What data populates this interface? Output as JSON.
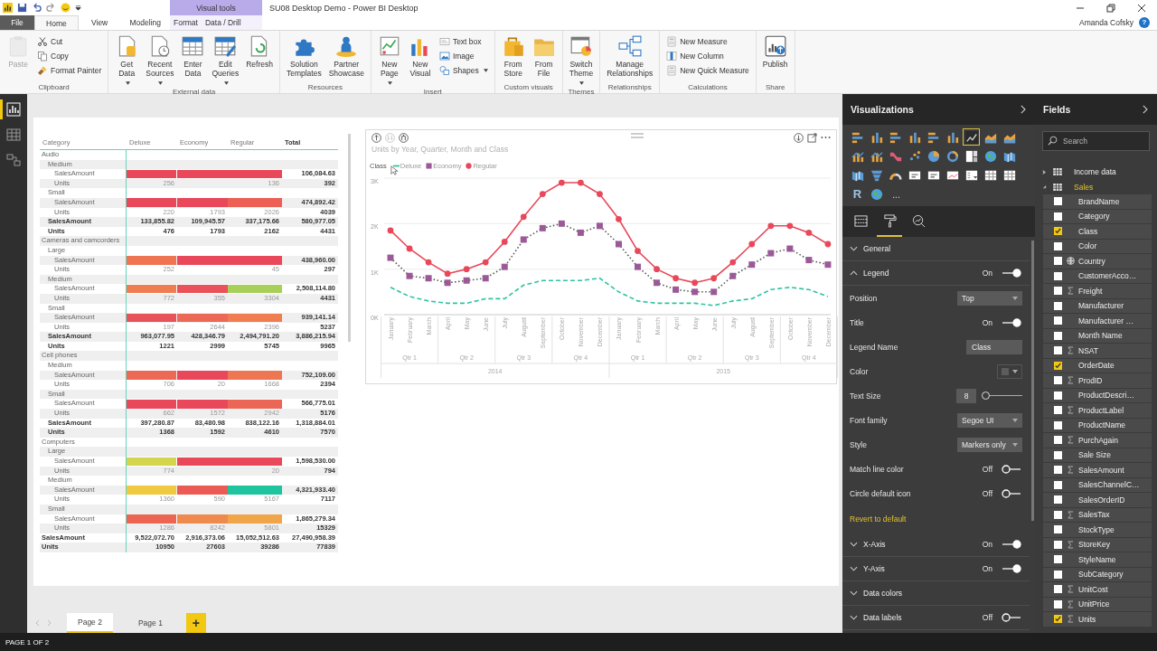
{
  "titlebar": {
    "context_group": "Visual tools",
    "title": "SU08 Desktop Demo - Power BI Desktop",
    "user": "Amanda Cofsky",
    "help": "?"
  },
  "tabs": [
    {
      "label": "File",
      "kind": "file",
      "selected": false
    },
    {
      "label": "Home",
      "kind": "standard",
      "selected": true
    },
    {
      "label": "View",
      "kind": "standard",
      "selected": false
    },
    {
      "label": "Modeling",
      "kind": "standard",
      "selected": false
    },
    {
      "label": "Format",
      "kind": "context",
      "selected": false
    },
    {
      "label": "Data / Drill",
      "kind": "context",
      "selected": false
    }
  ],
  "ribbon": {
    "groups": [
      {
        "label": "Clipboard",
        "buttons": [
          {
            "label": "Paste",
            "kind": "large",
            "dropdown": false,
            "disabled": true
          },
          {
            "label": "Cut",
            "kind": "small",
            "dropdown": false,
            "disabled": false
          },
          {
            "label": "Copy",
            "kind": "small",
            "dropdown": false,
            "disabled": false
          },
          {
            "label": "Format Painter",
            "kind": "small",
            "dropdown": false,
            "disabled": false
          }
        ]
      },
      {
        "label": "External data",
        "buttons": [
          {
            "label": "Get Data",
            "kind": "large",
            "dropdown": true,
            "disabled": false
          },
          {
            "label": "Recent Sources",
            "kind": "large",
            "dropdown": true,
            "disabled": false
          },
          {
            "label": "Enter Data",
            "kind": "large",
            "dropdown": false,
            "disabled": false
          },
          {
            "label": "Edit Queries",
            "kind": "large",
            "dropdown": true,
            "disabled": false
          },
          {
            "label": "Refresh",
            "kind": "large",
            "dropdown": false,
            "disabled": false
          }
        ]
      },
      {
        "label": "Resources",
        "buttons": [
          {
            "label": "Solution Templates",
            "kind": "large",
            "dropdown": false,
            "disabled": false
          },
          {
            "label": "Partner Showcase",
            "kind": "large",
            "dropdown": false,
            "disabled": false
          }
        ]
      },
      {
        "label": "Insert",
        "buttons": [
          {
            "label": "New Page",
            "kind": "large",
            "dropdown": true,
            "disabled": false
          },
          {
            "label": "New Visual",
            "kind": "large",
            "dropdown": false,
            "disabled": false
          },
          {
            "label": "Text box",
            "kind": "small",
            "dropdown": false,
            "disabled": false
          },
          {
            "label": "Image",
            "kind": "small",
            "dropdown": false,
            "disabled": false
          },
          {
            "label": "Shapes",
            "kind": "small",
            "dropdown": true,
            "disabled": false
          }
        ]
      },
      {
        "label": "Custom visuals",
        "buttons": [
          {
            "label": "From Store",
            "kind": "large",
            "dropdown": false,
            "disabled": false
          },
          {
            "label": "From File",
            "kind": "large",
            "dropdown": false,
            "disabled": false
          }
        ]
      },
      {
        "label": "Themes",
        "buttons": [
          {
            "label": "Switch Theme",
            "kind": "large",
            "dropdown": true,
            "disabled": false
          }
        ]
      },
      {
        "label": "Relationships",
        "buttons": [
          {
            "label": "Manage Relationships",
            "kind": "large",
            "dropdown": false,
            "disabled": false
          }
        ]
      },
      {
        "label": "Calculations",
        "buttons": [
          {
            "label": "New Measure",
            "kind": "small",
            "dropdown": false,
            "disabled": false
          },
          {
            "label": "New Column",
            "kind": "small",
            "dropdown": false,
            "disabled": false
          },
          {
            "label": "New Quick Measure",
            "kind": "small",
            "dropdown": false,
            "disabled": false
          }
        ]
      },
      {
        "label": "Share",
        "buttons": [
          {
            "label": "Publish",
            "kind": "large",
            "dropdown": false,
            "disabled": false
          }
        ]
      }
    ]
  },
  "views": [
    {
      "selected": true
    },
    {
      "selected": false
    },
    {
      "selected": false
    }
  ],
  "report": {
    "matrix": {
      "columns": [
        "Category",
        "Deluxe",
        "Economy",
        "Regular",
        "Total"
      ],
      "rows": [
        {
          "kind": "group",
          "label": "Audio",
          "children": [
            {
              "kind": "group",
              "label": "Medium",
              "children": [
                {
                  "kind": "bar",
                  "label": "SalesAmount",
                  "cells": [
                    {
                      "color": "#e8485a"
                    },
                    {
                      "color": "#e8485a"
                    },
                    {
                      "color": "#e8485a"
                    }
                  ],
                  "total": "106,084.63"
                },
                {
                  "kind": "value",
                  "label": "Units",
                  "values": {
                    "deluxe": "256",
                    "regular": "136"
                  },
                  "total": "392"
                }
              ]
            },
            {
              "kind": "group",
              "label": "Small",
              "children": [
                {
                  "kind": "bar",
                  "label": "SalesAmount",
                  "cells": [
                    {
                      "color": "#e8485a"
                    },
                    {
                      "color": "#e8485a"
                    },
                    {
                      "color": "#ec5f55"
                    }
                  ],
                  "total": "474,892.42"
                },
                {
                  "kind": "value",
                  "label": "Units",
                  "values": {
                    "deluxe": "220",
                    "economy": "1793",
                    "regular": "2026"
                  },
                  "total": "4039"
                }
              ]
            },
            {
              "kind": "total",
              "label": "SalesAmount",
              "values": {
                "deluxe": "133,855.82",
                "economy": "109,945.57",
                "regular": "337,175.66"
              },
              "total": "580,977.05"
            },
            {
              "kind": "total",
              "label": "Units",
              "values": {
                "deluxe": "476",
                "economy": "1793",
                "regular": "2162"
              },
              "total": "4431"
            }
          ]
        },
        {
          "kind": "group",
          "label": "Cameras and camcorders",
          "children": [
            {
              "kind": "group",
              "label": "Large",
              "children": [
                {
                  "kind": "bar",
                  "label": "SalesAmount",
                  "cells": [
                    {
                      "color": "#ef7452"
                    },
                    {
                      "color": "#e8485a"
                    },
                    {
                      "color": "#e8485a"
                    }
                  ],
                  "total": "438,960.00"
                },
                {
                  "kind": "value",
                  "label": "Units",
                  "values": {
                    "deluxe": "252",
                    "regular": "45"
                  },
                  "total": "297"
                }
              ]
            },
            {
              "kind": "group",
              "label": "Medium",
              "children": [
                {
                  "kind": "bar",
                  "label": "SalesAmount",
                  "cells": [
                    {
                      "color": "#ef7d52"
                    },
                    {
                      "color": "#e9525a"
                    },
                    {
                      "color": "#a8cf5a"
                    }
                  ],
                  "total": "2,508,114.80"
                },
                {
                  "kind": "value",
                  "label": "Units",
                  "values": {
                    "deluxe": "772",
                    "economy": "355",
                    "regular": "3304"
                  },
                  "total": "4431"
                }
              ]
            },
            {
              "kind": "group",
              "label": "Small",
              "children": [
                {
                  "kind": "bar",
                  "label": "SalesAmount",
                  "cells": [
                    {
                      "color": "#e8525a"
                    },
                    {
                      "color": "#ec6a55"
                    },
                    {
                      "color": "#ef7d50"
                    }
                  ],
                  "total": "939,141.14"
                },
                {
                  "kind": "value",
                  "label": "Units",
                  "values": {
                    "deluxe": "197",
                    "economy": "2644",
                    "regular": "2396"
                  },
                  "total": "5237"
                }
              ]
            },
            {
              "kind": "total",
              "label": "SalesAmount",
              "values": {
                "deluxe": "963,077.95",
                "economy": "428,346.79",
                "regular": "2,494,791.20"
              },
              "total": "3,886,215.94"
            },
            {
              "kind": "total",
              "label": "Units",
              "values": {
                "deluxe": "1221",
                "economy": "2999",
                "regular": "5745"
              },
              "total": "9965"
            }
          ]
        },
        {
          "kind": "group",
          "label": "Cell phones",
          "children": [
            {
              "kind": "group",
              "label": "Medium",
              "children": [
                {
                  "kind": "bar",
                  "label": "SalesAmount",
                  "cells": [
                    {
                      "color": "#ec6955"
                    },
                    {
                      "color": "#e8485a"
                    },
                    {
                      "color": "#ef7652"
                    }
                  ],
                  "total": "752,109.00"
                },
                {
                  "kind": "value",
                  "label": "Units",
                  "values": {
                    "deluxe": "706",
                    "economy": "20",
                    "regular": "1668"
                  },
                  "total": "2394"
                }
              ]
            },
            {
              "kind": "group",
              "label": "Small",
              "children": [
                {
                  "kind": "bar",
                  "label": "SalesAmount",
                  "cells": [
                    {
                      "color": "#e8485a"
                    },
                    {
                      "color": "#e8485a"
                    },
                    {
                      "color": "#ec6655"
                    }
                  ],
                  "total": "566,775.01"
                },
                {
                  "kind": "value",
                  "label": "Units",
                  "values": {
                    "deluxe": "662",
                    "economy": "1572",
                    "regular": "2942"
                  },
                  "total": "5176"
                }
              ]
            },
            {
              "kind": "total",
              "label": "SalesAmount",
              "values": {
                "deluxe": "397,280.87",
                "economy": "83,480.98",
                "regular": "838,122.16"
              },
              "total": "1,318,884.01"
            },
            {
              "kind": "total",
              "label": "Units",
              "values": {
                "deluxe": "1368",
                "economy": "1592",
                "regular": "4610"
              },
              "total": "7570"
            }
          ]
        },
        {
          "kind": "group",
          "label": "Computers",
          "children": [
            {
              "kind": "group",
              "label": "Large",
              "children": [
                {
                  "kind": "bar",
                  "label": "SalesAmount",
                  "cells": [
                    {
                      "color": "#d4d54b"
                    },
                    {
                      "color": "#e8485a"
                    },
                    {
                      "color": "#e8485a"
                    }
                  ],
                  "total": "1,598,530.00"
                },
                {
                  "kind": "value",
                  "label": "Units",
                  "values": {
                    "deluxe": "774",
                    "regular": "20"
                  },
                  "total": "794"
                }
              ]
            },
            {
              "kind": "group",
              "label": "Medium",
              "children": [
                {
                  "kind": "bar",
                  "label": "SalesAmount",
                  "cells": [
                    {
                      "color": "#f0c93f"
                    },
                    {
                      "color": "#ec5a55"
                    },
                    {
                      "color": "#1ec49e"
                    }
                  ],
                  "total": "4,321,933.40"
                },
                {
                  "kind": "value",
                  "label": "Units",
                  "values": {
                    "deluxe": "1360",
                    "economy": "590",
                    "regular": "5167"
                  },
                  "total": "7117"
                }
              ]
            },
            {
              "kind": "group",
              "label": "Small",
              "children": [
                {
                  "kind": "bar",
                  "label": "SalesAmount",
                  "cells": [
                    {
                      "color": "#ec6552"
                    },
                    {
                      "color": "#ef8a4e"
                    },
                    {
                      "color": "#f0a548"
                    }
                  ],
                  "total": "1,865,279.34"
                },
                {
                  "kind": "value",
                  "label": "Units",
                  "values": {
                    "deluxe": "1286",
                    "economy": "8242",
                    "regular": "5801"
                  },
                  "total": "15329"
                }
              ]
            }
          ]
        },
        {
          "kind": "total",
          "label": "SalesAmount",
          "values": {
            "deluxe": "9,522,072.70",
            "economy": "2,916,373.06",
            "regular": "15,052,512.63"
          },
          "total": "27,490,958.39"
        },
        {
          "kind": "total",
          "label": "Units",
          "values": {
            "deluxe": "10950",
            "economy": "27603",
            "regular": "39286"
          },
          "total": "77839"
        }
      ]
    },
    "chart": {
      "x_axis": {
        "quarters": [
          "Qtr 1",
          "Qtr 2",
          "Qtr 3",
          "Qtr 4",
          "Qtr 1",
          "Qtr 2",
          "Qtr 3",
          "Qtr 4"
        ],
        "years": [
          "2014",
          "2015"
        ]
      },
      "chart_data": {
        "type": "line",
        "title": "Units by Year, Quarter, Month and Class",
        "legend": {
          "title": "Class"
        },
        "categories": [
          "January",
          "February",
          "March",
          "April",
          "May",
          "June",
          "July",
          "August",
          "September",
          "October",
          "November",
          "December",
          "January",
          "February",
          "March",
          "April",
          "May",
          "June",
          "July",
          "August",
          "September",
          "October",
          "November",
          "December"
        ],
        "ylim": [
          0,
          3000
        ],
        "yticks": [
          {
            "value": 0,
            "label": "0K"
          },
          {
            "value": 1000,
            "label": "1K"
          },
          {
            "value": 2000,
            "label": "2K"
          },
          {
            "value": 3000,
            "label": "3K"
          }
        ],
        "series": [
          {
            "name": "Deluxe",
            "color": "#2ec4a0",
            "line_style": "dashed",
            "marker": "none",
            "values": [
              600,
              400,
              300,
              250,
              250,
              350,
              350,
              650,
              750,
              750,
              750,
              800,
              500,
              300,
              250,
              250,
              250,
              200,
              300,
              350,
              550,
              600,
              550,
              400
            ]
          },
          {
            "name": "Economy",
            "color": "#9b5a97",
            "line_style": "dotted",
            "marker": "square",
            "values": [
              1250,
              850,
              800,
              700,
              750,
              800,
              1050,
              1650,
              1900,
              2000,
              1800,
              1950,
              1550,
              1050,
              700,
              550,
              500,
              500,
              850,
              1100,
              1350,
              1450,
              1200,
              1100
            ]
          },
          {
            "name": "Regular",
            "color": "#e8485a",
            "line_style": "solid",
            "marker": "circle",
            "values": [
              1850,
              1450,
              1150,
              900,
              1000,
              1150,
              1600,
              2150,
              2650,
              2900,
              2900,
              2650,
              2100,
              1400,
              1000,
              800,
              700,
              800,
              1150,
              1550,
              1950,
              1950,
              1800,
              1550
            ]
          }
        ]
      }
    }
  },
  "pages": [
    {
      "label": "Page 2",
      "selected": true
    },
    {
      "label": "Page 1",
      "selected": false
    }
  ],
  "add_page": "+",
  "status": "PAGE 1 OF 2",
  "visualizations_pane": {
    "title": "Visualizations",
    "visuals": [
      {
        "selected": false
      },
      {
        "selected": false
      },
      {
        "selected": false
      },
      {
        "selected": false
      },
      {
        "selected": false
      },
      {
        "selected": false
      },
      {
        "selected": true
      },
      {
        "selected": false
      },
      {
        "selected": false
      },
      {
        "selected": false
      },
      {
        "selected": false
      },
      {
        "selected": false
      },
      {
        "selected": false
      },
      {
        "selected": false
      },
      {
        "selected": false
      },
      {
        "selected": false
      },
      {
        "selected": false
      },
      {
        "selected": false
      },
      {
        "selected": false
      },
      {
        "selected": false
      },
      {
        "selected": false
      },
      {
        "selected": false
      },
      {
        "selected": false
      },
      {
        "selected": false
      },
      {
        "selected": false
      },
      {
        "selected": false
      },
      {
        "selected": false
      },
      {
        "label": "R",
        "selected": false
      },
      {
        "selected": false
      }
    ],
    "more": "...",
    "tabs": [
      {
        "selected": false
      },
      {
        "selected": true
      },
      {
        "selected": false
      }
    ],
    "items": [
      {
        "kind": "section",
        "label": "General",
        "expanded": false
      },
      {
        "kind": "section",
        "label": "Legend",
        "expanded": true,
        "toggle": {
          "label": "On",
          "on": true
        }
      },
      {
        "kind": "dropdown",
        "label": "Position",
        "value": "Top"
      },
      {
        "kind": "toggle",
        "label": "Title",
        "toggle": {
          "label": "On",
          "on": true
        }
      },
      {
        "kind": "text",
        "label": "Legend Name",
        "value": "Class"
      },
      {
        "kind": "color",
        "label": "Color",
        "color": "#5c5c5c"
      },
      {
        "kind": "slider",
        "label": "Text Size",
        "value": "8",
        "level": 0
      },
      {
        "kind": "dropdown",
        "label": "Font family",
        "value": "Segoe UI"
      },
      {
        "kind": "dropdown",
        "label": "Style",
        "value": "Markers only"
      },
      {
        "kind": "toggle",
        "label": "Match line color",
        "toggle": {
          "label": "Off",
          "on": false
        }
      },
      {
        "kind": "toggle",
        "label": "Circle default icon",
        "toggle": {
          "label": "Off",
          "on": false
        }
      },
      {
        "kind": "link",
        "label": "Revert to default"
      },
      {
        "kind": "section",
        "label": "X-Axis",
        "expanded": false,
        "toggle": {
          "label": "On",
          "on": true
        }
      },
      {
        "kind": "section",
        "label": "Y-Axis",
        "expanded": false,
        "toggle": {
          "label": "On",
          "on": true
        }
      },
      {
        "kind": "section",
        "label": "Data colors",
        "expanded": false
      },
      {
        "kind": "section",
        "label": "Data labels",
        "expanded": false,
        "toggle": {
          "label": "Off",
          "on": false
        }
      }
    ]
  },
  "fields_pane": {
    "title": "Fields",
    "search": {
      "placeholder": "Search"
    },
    "tables": [
      {
        "label": "Income data",
        "expanded": false,
        "active": false
      },
      {
        "label": "Sales",
        "expanded": true,
        "active": true,
        "children": [
          {
            "label": "BrandName",
            "kind": "text",
            "checked": false
          },
          {
            "label": "Category",
            "kind": "text",
            "checked": false
          },
          {
            "label": "Class",
            "kind": "text",
            "checked": true
          },
          {
            "label": "Color",
            "kind": "text",
            "checked": false
          },
          {
            "label": "Country",
            "kind": "geo",
            "checked": false
          },
          {
            "label": "CustomerAcco…",
            "kind": "text",
            "checked": false
          },
          {
            "label": "Freight",
            "kind": "sum",
            "checked": false
          },
          {
            "label": "Manufacturer",
            "kind": "text",
            "checked": false
          },
          {
            "label": "Manufacturer …",
            "kind": "text",
            "checked": false
          },
          {
            "label": "Month Name",
            "kind": "text",
            "checked": false
          },
          {
            "label": "NSAT",
            "kind": "sum",
            "checked": false
          },
          {
            "label": "OrderDate",
            "kind": "text",
            "checked": true
          },
          {
            "label": "ProdID",
            "kind": "sum",
            "checked": false
          },
          {
            "label": "ProductDescri…",
            "kind": "text",
            "checked": false
          },
          {
            "label": "ProductLabel",
            "kind": "sum",
            "checked": false
          },
          {
            "label": "ProductName",
            "kind": "text",
            "checked": false
          },
          {
            "label": "PurchAgain",
            "kind": "sum",
            "checked": false
          },
          {
            "label": "Sale Size",
            "kind": "text",
            "checked": false
          },
          {
            "label": "SalesAmount",
            "kind": "sum",
            "checked": false
          },
          {
            "label": "SalesChannelC…",
            "kind": "text",
            "checked": false
          },
          {
            "label": "SalesOrderID",
            "kind": "text",
            "checked": false
          },
          {
            "label": "SalesTax",
            "kind": "sum",
            "checked": false
          },
          {
            "label": "StockType",
            "kind": "text",
            "checked": false
          },
          {
            "label": "StoreKey",
            "kind": "sum",
            "checked": false
          },
          {
            "label": "StyleName",
            "kind": "text",
            "checked": false
          },
          {
            "label": "SubCategory",
            "kind": "text",
            "checked": false
          },
          {
            "label": "UnitCost",
            "kind": "sum",
            "checked": false
          },
          {
            "label": "UnitPrice",
            "kind": "sum",
            "checked": false
          },
          {
            "label": "Units",
            "kind": "sum",
            "checked": true
          }
        ]
      }
    ]
  }
}
